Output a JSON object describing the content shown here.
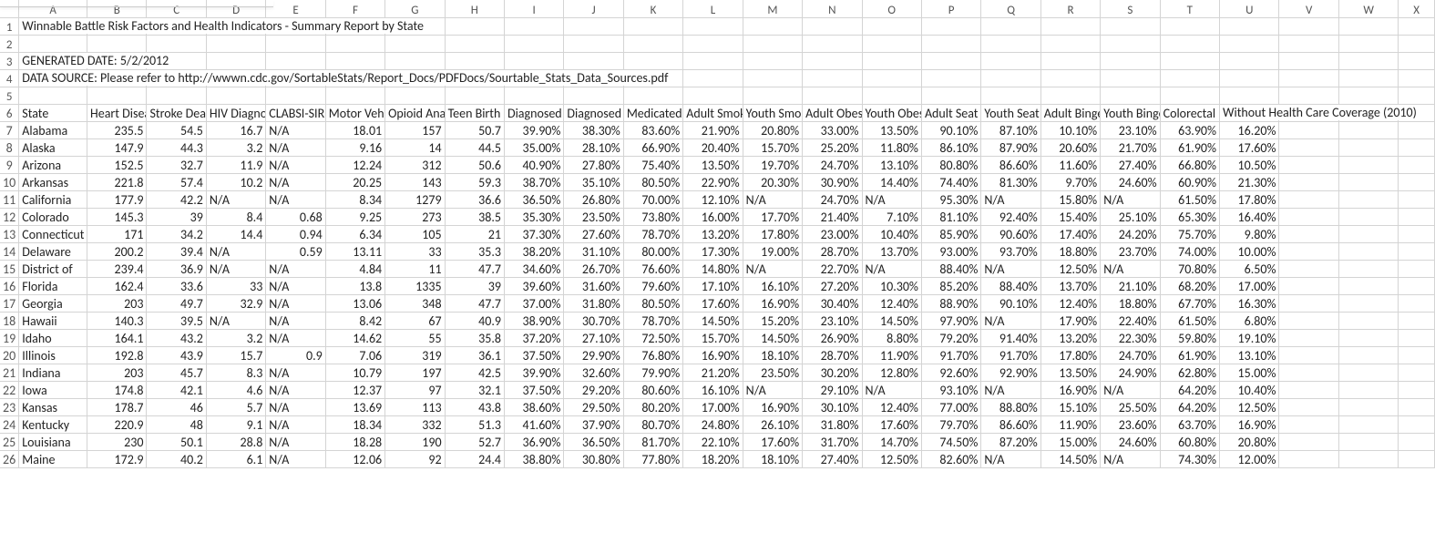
{
  "report": {
    "title": "Winnable Battle Risk Factors and Health Indicators - Summary Report by State",
    "generated": "GENERATED DATE: 5/2/2012",
    "source": "DATA SOURCE: Please refer to http://wwwn.cdc.gov/SortableStats/Report_Docs/PDFDocs/Sourtable_Stats_Data_Sources.pdf"
  },
  "col_letters": [
    "A",
    "B",
    "C",
    "D",
    "E",
    "F",
    "G",
    "H",
    "I",
    "J",
    "K",
    "L",
    "M",
    "N",
    "O",
    "P",
    "Q",
    "R",
    "S",
    "T",
    "U",
    "V",
    "W",
    "X"
  ],
  "headers": [
    "State",
    "Heart Disease",
    "Stroke Deaths",
    "HIV Diagnoses",
    "CLABSI-SIR",
    "Motor Vehicle",
    "Opioid Analgesic",
    "Teen Birth",
    "Diagnosed",
    "Diagnosed",
    "Medicated",
    "Adult Smoking",
    "Youth Smoking",
    "Adult Obesity",
    "Youth Obesity",
    "Adult Seat",
    "Youth Seat",
    "Adult Binge",
    "Youth Binge",
    "Colorectal",
    "Without Health Care Coverage (2010)",
    "",
    "",
    ""
  ],
  "rows": [
    {
      "n": 7,
      "cells": [
        "Alabama",
        "235.5",
        "54.5",
        "16.7",
        "N/A",
        "18.01",
        "157",
        "50.7",
        "39.90%",
        "38.30%",
        "83.60%",
        "21.90%",
        "20.80%",
        "33.00%",
        "13.50%",
        "90.10%",
        "87.10%",
        "10.10%",
        "23.10%",
        "63.90%",
        "16.20%"
      ]
    },
    {
      "n": 8,
      "cells": [
        "Alaska",
        "147.9",
        "44.3",
        "3.2",
        "N/A",
        "9.16",
        "14",
        "44.5",
        "35.00%",
        "28.10%",
        "66.90%",
        "20.40%",
        "15.70%",
        "25.20%",
        "11.80%",
        "86.10%",
        "87.90%",
        "20.60%",
        "21.70%",
        "61.90%",
        "17.60%"
      ]
    },
    {
      "n": 9,
      "cells": [
        "Arizona",
        "152.5",
        "32.7",
        "11.9",
        "N/A",
        "12.24",
        "312",
        "50.6",
        "40.90%",
        "27.80%",
        "75.40%",
        "13.50%",
        "19.70%",
        "24.70%",
        "13.10%",
        "80.80%",
        "86.60%",
        "11.60%",
        "27.40%",
        "66.80%",
        "10.50%"
      ]
    },
    {
      "n": 10,
      "cells": [
        "Arkansas",
        "221.8",
        "57.4",
        "10.2",
        "N/A",
        "20.25",
        "143",
        "59.3",
        "38.70%",
        "35.10%",
        "80.50%",
        "22.90%",
        "20.30%",
        "30.90%",
        "14.40%",
        "74.40%",
        "81.30%",
        "9.70%",
        "24.60%",
        "60.90%",
        "21.30%"
      ]
    },
    {
      "n": 11,
      "cells": [
        "California",
        "177.9",
        "42.2",
        "N/A",
        "N/A",
        "8.34",
        "1279",
        "36.6",
        "36.50%",
        "26.80%",
        "70.00%",
        "12.10%",
        "N/A",
        "24.70%",
        "N/A",
        "95.30%",
        "N/A",
        "15.80%",
        "N/A",
        "61.50%",
        "17.80%"
      ]
    },
    {
      "n": 12,
      "cells": [
        "Colorado",
        "145.3",
        "39",
        "8.4",
        "0.68",
        "9.25",
        "273",
        "38.5",
        "35.30%",
        "23.50%",
        "73.80%",
        "16.00%",
        "17.70%",
        "21.40%",
        "7.10%",
        "81.10%",
        "92.40%",
        "15.40%",
        "25.10%",
        "65.30%",
        "16.40%"
      ]
    },
    {
      "n": 13,
      "cells": [
        "Connecticut",
        "171",
        "34.2",
        "14.4",
        "0.94",
        "6.34",
        "105",
        "21",
        "37.30%",
        "27.60%",
        "78.70%",
        "13.20%",
        "17.80%",
        "23.00%",
        "10.40%",
        "85.90%",
        "90.60%",
        "17.40%",
        "24.20%",
        "75.70%",
        "9.80%"
      ]
    },
    {
      "n": 14,
      "cells": [
        "Delaware",
        "200.2",
        "39.4",
        "N/A",
        "0.59",
        "13.11",
        "33",
        "35.3",
        "38.20%",
        "31.10%",
        "80.00%",
        "17.30%",
        "19.00%",
        "28.70%",
        "13.70%",
        "93.00%",
        "93.70%",
        "18.80%",
        "23.70%",
        "74.00%",
        "10.00%"
      ]
    },
    {
      "n": 15,
      "cells": [
        "District of",
        "239.4",
        "36.9",
        "N/A",
        "N/A",
        "4.84",
        "11",
        "47.7",
        "34.60%",
        "26.70%",
        "76.60%",
        "14.80%",
        "N/A",
        "22.70%",
        "N/A",
        "88.40%",
        "N/A",
        "12.50%",
        "N/A",
        "70.80%",
        "6.50%"
      ]
    },
    {
      "n": 16,
      "cells": [
        "Florida",
        "162.4",
        "33.6",
        "33",
        "N/A",
        "13.8",
        "1335",
        "39",
        "39.60%",
        "31.60%",
        "79.60%",
        "17.10%",
        "16.10%",
        "27.20%",
        "10.30%",
        "85.20%",
        "88.40%",
        "13.70%",
        "21.10%",
        "68.20%",
        "17.00%"
      ]
    },
    {
      "n": 17,
      "cells": [
        "Georgia",
        "203",
        "49.7",
        "32.9",
        "N/A",
        "13.06",
        "348",
        "47.7",
        "37.00%",
        "31.80%",
        "80.50%",
        "17.60%",
        "16.90%",
        "30.40%",
        "12.40%",
        "88.90%",
        "90.10%",
        "12.40%",
        "18.80%",
        "67.70%",
        "16.30%"
      ]
    },
    {
      "n": 18,
      "cells": [
        "Hawaii",
        "140.3",
        "39.5",
        "N/A",
        "N/A",
        "8.42",
        "67",
        "40.9",
        "38.90%",
        "30.70%",
        "78.70%",
        "14.50%",
        "15.20%",
        "23.10%",
        "14.50%",
        "97.90%",
        "N/A",
        "17.90%",
        "22.40%",
        "61.50%",
        "6.80%"
      ]
    },
    {
      "n": 19,
      "cells": [
        "Idaho",
        "164.1",
        "43.2",
        "3.2",
        "N/A",
        "14.62",
        "55",
        "35.8",
        "37.20%",
        "27.10%",
        "72.50%",
        "15.70%",
        "14.50%",
        "26.90%",
        "8.80%",
        "79.20%",
        "91.40%",
        "13.20%",
        "22.30%",
        "59.80%",
        "19.10%"
      ]
    },
    {
      "n": 20,
      "cells": [
        "Illinois",
        "192.8",
        "43.9",
        "15.7",
        "0.9",
        "7.06",
        "319",
        "36.1",
        "37.50%",
        "29.90%",
        "76.80%",
        "16.90%",
        "18.10%",
        "28.70%",
        "11.90%",
        "91.70%",
        "91.70%",
        "17.80%",
        "24.70%",
        "61.90%",
        "13.10%"
      ]
    },
    {
      "n": 21,
      "cells": [
        "Indiana",
        "203",
        "45.7",
        "8.3",
        "N/A",
        "10.79",
        "197",
        "42.5",
        "39.90%",
        "32.60%",
        "79.90%",
        "21.20%",
        "23.50%",
        "30.20%",
        "12.80%",
        "92.60%",
        "92.90%",
        "13.50%",
        "24.90%",
        "62.80%",
        "15.00%"
      ]
    },
    {
      "n": 22,
      "cells": [
        "Iowa",
        "174.8",
        "42.1",
        "4.6",
        "N/A",
        "12.37",
        "97",
        "32.1",
        "37.50%",
        "29.20%",
        "80.60%",
        "16.10%",
        "N/A",
        "29.10%",
        "N/A",
        "93.10%",
        "N/A",
        "16.90%",
        "N/A",
        "64.20%",
        "10.40%"
      ]
    },
    {
      "n": 23,
      "cells": [
        "Kansas",
        "178.7",
        "46",
        "5.7",
        "N/A",
        "13.69",
        "113",
        "43.8",
        "38.60%",
        "29.50%",
        "80.20%",
        "17.00%",
        "16.90%",
        "30.10%",
        "12.40%",
        "77.00%",
        "88.80%",
        "15.10%",
        "25.50%",
        "64.20%",
        "12.50%"
      ]
    },
    {
      "n": 24,
      "cells": [
        "Kentucky",
        "220.9",
        "48",
        "9.1",
        "N/A",
        "18.34",
        "332",
        "51.3",
        "41.60%",
        "37.90%",
        "80.70%",
        "24.80%",
        "26.10%",
        "31.80%",
        "17.60%",
        "79.70%",
        "86.60%",
        "11.90%",
        "23.60%",
        "63.70%",
        "16.90%"
      ]
    },
    {
      "n": 25,
      "cells": [
        "Louisiana",
        "230",
        "50.1",
        "28.8",
        "N/A",
        "18.28",
        "190",
        "52.7",
        "36.90%",
        "36.50%",
        "81.70%",
        "22.10%",
        "17.60%",
        "31.70%",
        "14.70%",
        "74.50%",
        "87.20%",
        "15.00%",
        "24.60%",
        "60.80%",
        "20.80%"
      ]
    },
    {
      "n": 26,
      "cells": [
        "Maine",
        "172.9",
        "40.2",
        "6.1",
        "N/A",
        "12.06",
        "92",
        "24.4",
        "38.80%",
        "30.80%",
        "77.80%",
        "18.20%",
        "18.10%",
        "27.40%",
        "12.50%",
        "82.60%",
        "N/A",
        "14.50%",
        "N/A",
        "74.30%",
        "12.00%"
      ]
    }
  ]
}
